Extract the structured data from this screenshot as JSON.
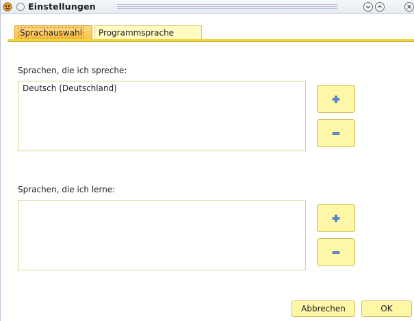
{
  "window": {
    "title": "Einstellungen",
    "icon": "app-face-icon",
    "buttons": {
      "minimize_icon": "chevron-down-icon",
      "maximize_icon": "chevron-up-icon",
      "close_icon": "close-icon"
    }
  },
  "tabs": [
    {
      "label": "Sprachauswahl",
      "active": true
    },
    {
      "label": "Programmsprache",
      "active": false
    }
  ],
  "spoken": {
    "label": "Sprachen, die ich spreche:",
    "items": [
      "Deutsch (Deutschland)"
    ],
    "add_icon": "plus-icon",
    "remove_icon": "minus-icon"
  },
  "learning": {
    "label": "Sprachen, die ich lerne:",
    "items": [],
    "add_icon": "plus-icon",
    "remove_icon": "minus-icon"
  },
  "footer": {
    "cancel_label": "Abbrechen",
    "ok_label": "OK"
  },
  "colors": {
    "accent_tab": "#ffc044",
    "button_fill": "#fff7a8",
    "tab_line": "#f0d63a",
    "icon_blue": "#5b8fd6"
  }
}
